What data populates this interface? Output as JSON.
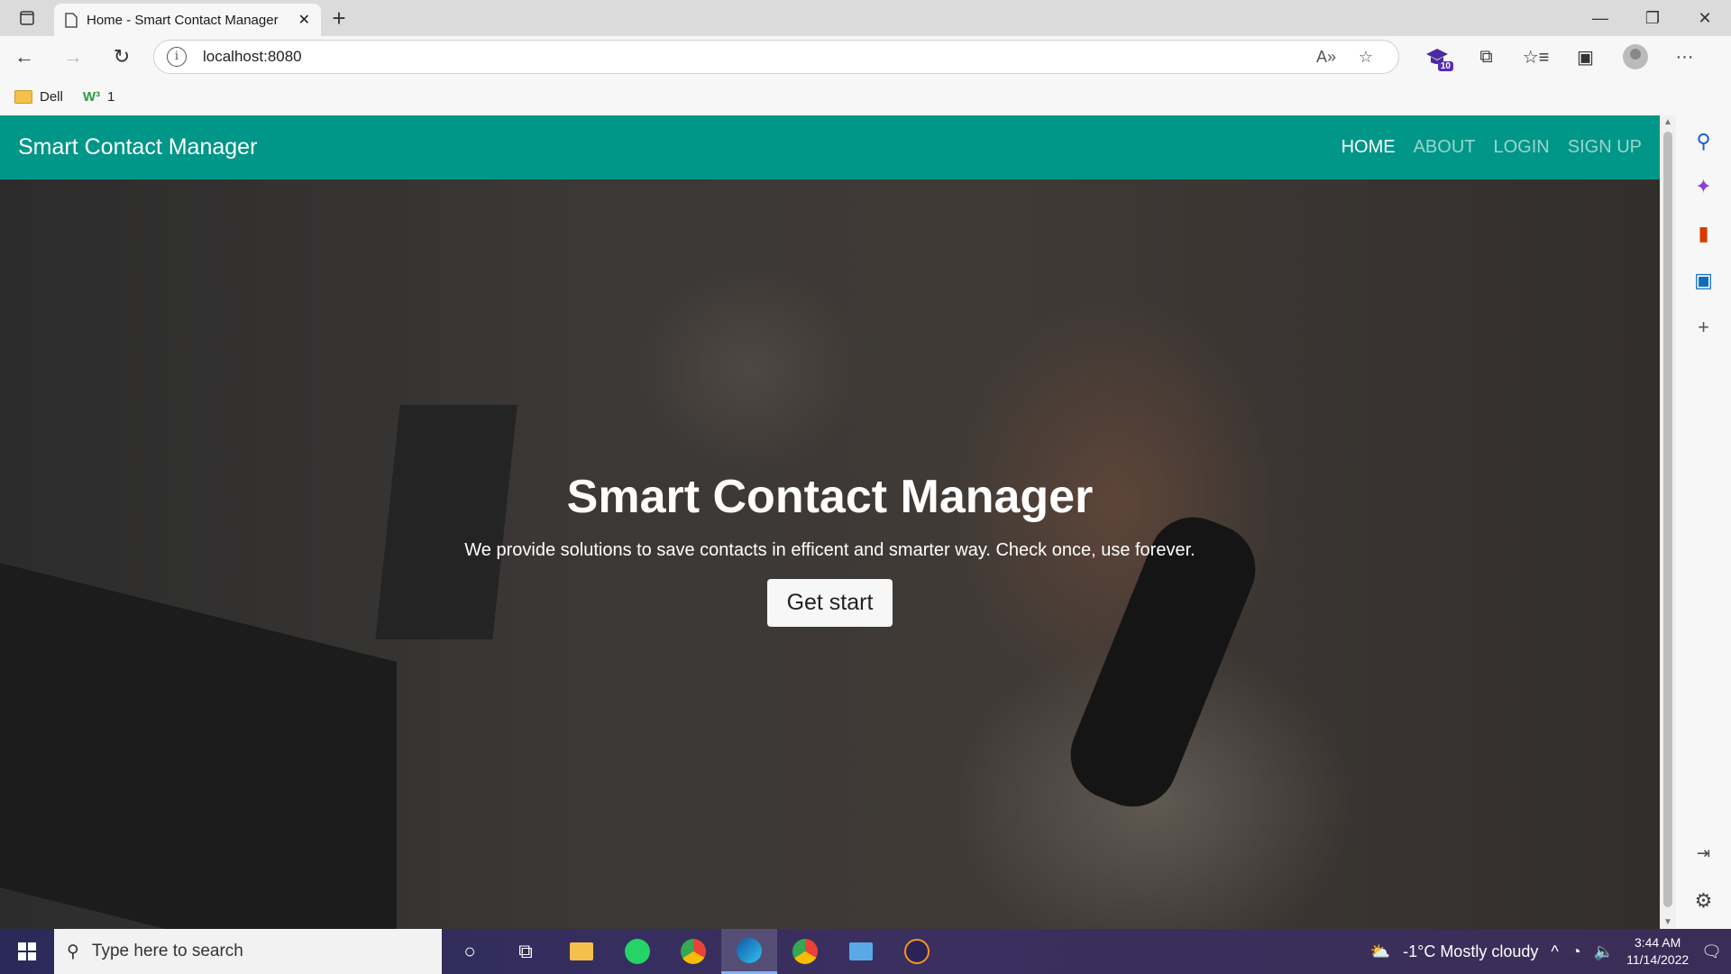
{
  "browser": {
    "tab_title": "Home - Smart Contact Manager",
    "url": "localhost:8080",
    "extension_badge": "10",
    "favorites": [
      {
        "label": "Dell"
      },
      {
        "label": "1"
      }
    ]
  },
  "site": {
    "brand": "Smart Contact Manager",
    "nav": [
      "HOME",
      "ABOUT",
      "LOGIN",
      "SIGN UP"
    ],
    "active_nav": "HOME",
    "hero_title": "Smart Contact Manager",
    "hero_subtitle": "We provide solutions to save contacts in efficent and smarter way. Check once, use forever.",
    "cta_label": "Get start",
    "nav_color": "#009688"
  },
  "taskbar": {
    "search_placeholder": "Type here to search",
    "weather": "-1°C  Mostly cloudy",
    "time": "3:44 AM",
    "date": "11/14/2022"
  }
}
